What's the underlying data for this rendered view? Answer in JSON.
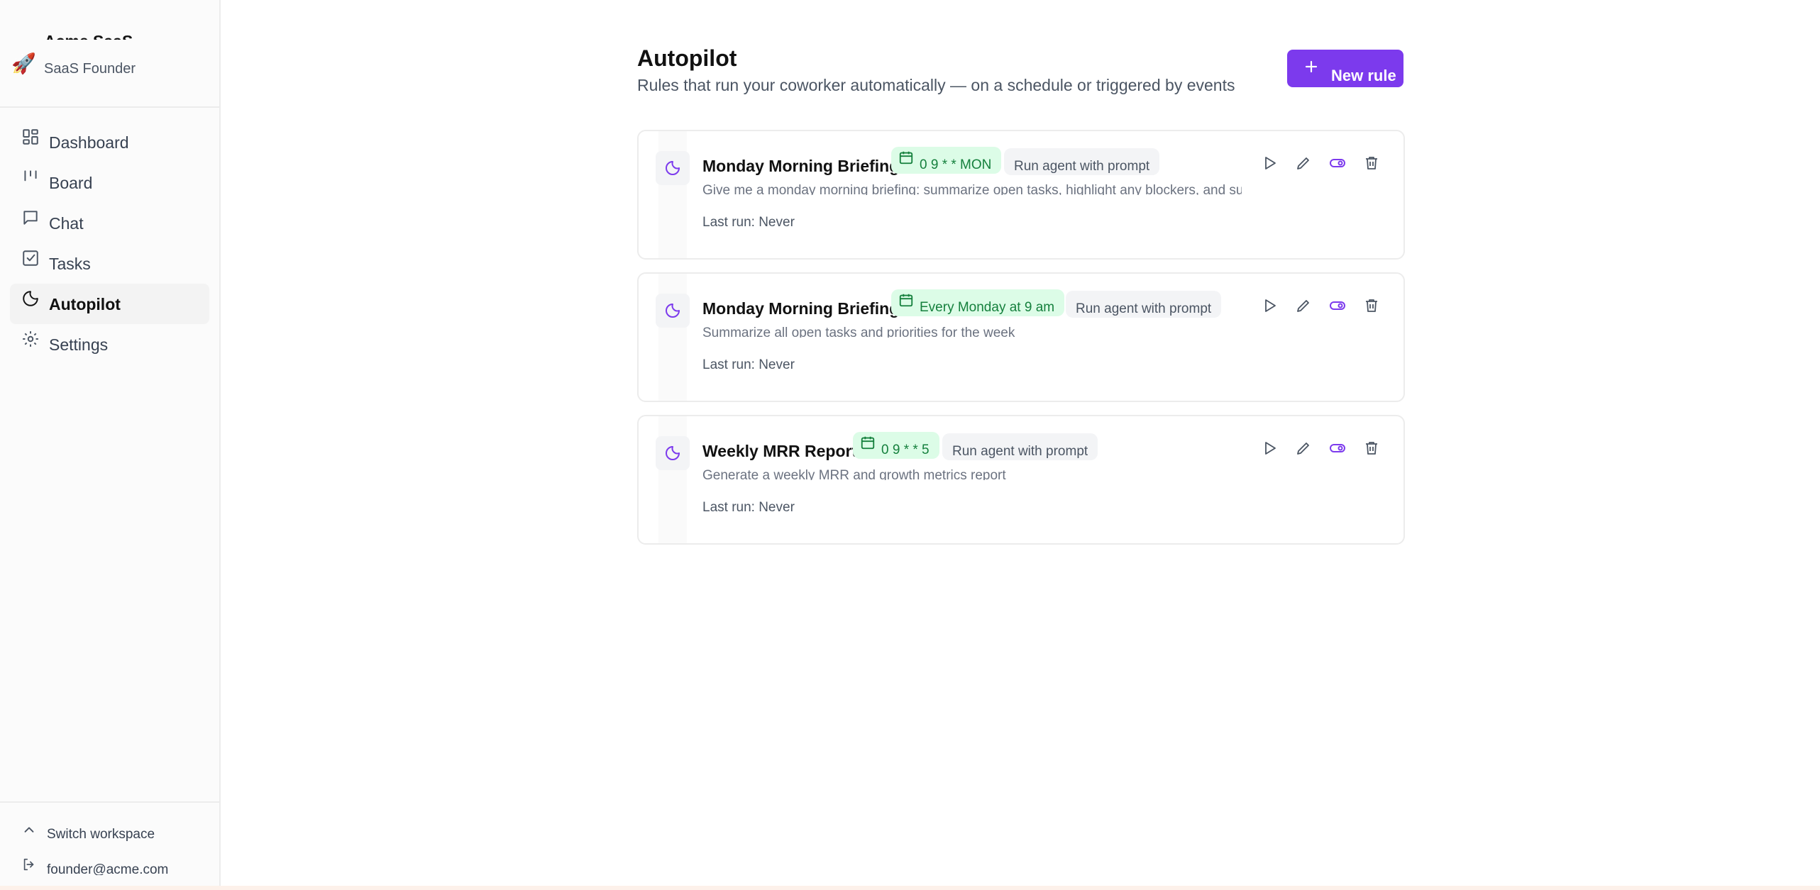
{
  "sidebar": {
    "workspace_name": "Acme SaaS",
    "workspace_logo": "🚀",
    "workspace_subtitle": "SaaS Founder",
    "nav": [
      {
        "label": "Dashboard",
        "icon": "dashboard-icon",
        "active": false
      },
      {
        "label": "Board",
        "icon": "board-icon",
        "active": false
      },
      {
        "label": "Chat",
        "icon": "chat-icon",
        "active": false
      },
      {
        "label": "Tasks",
        "icon": "tasks-icon",
        "active": false
      },
      {
        "label": "Autopilot",
        "icon": "moon-icon",
        "active": true
      },
      {
        "label": "Settings",
        "icon": "gear-icon",
        "active": false
      }
    ],
    "switch_workspace": "Switch workspace",
    "user_email": "founder@acme.com"
  },
  "header": {
    "title": "Autopilot",
    "subtitle": "Rules that run your coworker automatically — on a schedule or triggered by events",
    "new_rule_label": "New rule"
  },
  "rules": [
    {
      "name": "Monday Morning Briefing",
      "schedule": "0 9 * * MON",
      "action": "Run agent with prompt",
      "description": "Give me a monday morning briefing: summarize open tasks, highlight any blockers, and suggest priorities for the week",
      "last_run": "Last run: Never",
      "enabled": true
    },
    {
      "name": "Monday Morning Briefing",
      "schedule": "Every Monday at 9 am",
      "action": "Run agent with prompt",
      "description": "Summarize all open tasks and priorities for the week",
      "last_run": "Last run: Never",
      "enabled": true
    },
    {
      "name": "Weekly MRR Report",
      "schedule": "0 9 * * 5",
      "action": "Run agent with prompt",
      "description": "Generate a weekly MRR and growth metrics report",
      "last_run": "Last run: Never",
      "enabled": true
    }
  ],
  "colors": {
    "accent": "#7c3aed",
    "schedule_bg": "#dcfce7",
    "schedule_text": "#15803d"
  }
}
